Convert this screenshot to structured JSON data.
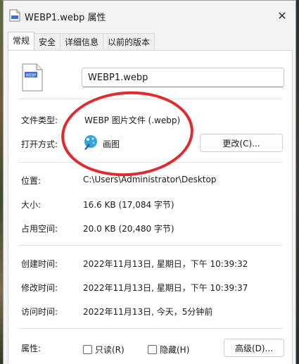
{
  "window": {
    "title": "WEBP1.webp 属性",
    "close_glyph": "✕"
  },
  "tabs": [
    {
      "label": "常规",
      "active": true
    },
    {
      "label": "安全"
    },
    {
      "label": "详细信息"
    },
    {
      "label": "以前的版本"
    }
  ],
  "file": {
    "icon": "webp-file-icon",
    "name": "WEBP1.webp"
  },
  "type": {
    "label": "文件类型:",
    "value": "WEBP 图片文件 (.webp)"
  },
  "opens_with": {
    "label": "打开方式:",
    "app_icon": "paint-app-icon",
    "app_name": "画图",
    "change_button": "更改(C)..."
  },
  "location": {
    "label": "位置:",
    "value": "C:\\Users\\Administrator\\Desktop"
  },
  "size": {
    "label": "大小:",
    "value": "16.6 KB (17,084 字节)"
  },
  "size_on_disk": {
    "label": "占用空间:",
    "value": "20.0 KB (20,480 字节)"
  },
  "created": {
    "label": "创建时间:",
    "value": "2022年11月13日, 星期日，下午 10:39:32"
  },
  "modified": {
    "label": "修改时间:",
    "value": "2022年11月13日, 星期日，下午 10:39:37"
  },
  "accessed": {
    "label": "访问时间:",
    "value": "2022年11月13日, 今天，5分钟前"
  },
  "attributes": {
    "label": "属性:",
    "readonly": {
      "label": "只读(R)",
      "checked": false
    },
    "hidden": {
      "label": "隐藏(H)",
      "checked": false
    },
    "advanced_button": "高级(D)..."
  },
  "colors": {
    "annotation": "#e12a2f",
    "window_bg": "#f3f3f3",
    "panel_bg": "#ffffff"
  }
}
